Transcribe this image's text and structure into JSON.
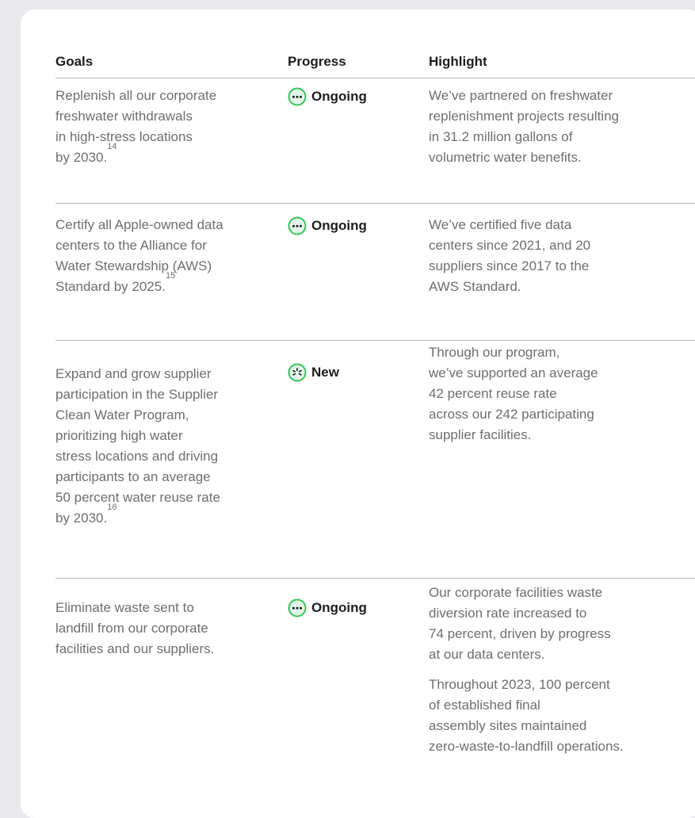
{
  "colors": {
    "accent_green": "#34c759",
    "text_primary": "#1d1d1f",
    "text_secondary": "#6e6e73",
    "rule": "#b8b8bd"
  },
  "header": {
    "goals": "Goals",
    "progress": "Progress",
    "highlight": "Highlight"
  },
  "rows": [
    {
      "goal_lines": [
        "Replenish all our corporate",
        "freshwater withdrawals",
        "in high-stress locations",
        "by 2030."
      ],
      "footnote": "14",
      "status": "Ongoing",
      "status_icon": "ellipsis-circle-icon",
      "highlight": [
        [
          "We’ve partnered on freshwater",
          "replenishment projects resulting",
          "in 31.2 million gallons of",
          "volumetric water benefits."
        ]
      ]
    },
    {
      "goal_lines": [
        "Certify all Apple-owned data",
        "centers to the Alliance for",
        "Water Stewardship (AWS)",
        "Standard by 2025."
      ],
      "footnote": "15",
      "status": "Ongoing",
      "status_icon": "ellipsis-circle-icon",
      "highlight": [
        [
          "We’ve certified five data",
          "centers since 2021, and 20",
          "suppliers since 2017 to the",
          "AWS Standard."
        ]
      ]
    },
    {
      "goal_lines": [
        "Expand and grow supplier",
        "participation in the Supplier",
        "Clean Water Program,",
        "prioritizing high water",
        "stress locations and driving",
        "participants to an average",
        "50 percent water reuse rate",
        "by 2030."
      ],
      "footnote": "16",
      "status": "New",
      "status_icon": "sparkle-burst-circle-icon",
      "highlight": [
        [
          "Through our program,",
          "we’ve supported an average",
          "42 percent reuse rate",
          "across our 242 participating",
          "supplier facilities."
        ]
      ]
    },
    {
      "goal_lines": [
        "Eliminate waste sent to",
        "landfill from our corporate",
        "facilities and our suppliers."
      ],
      "footnote": "",
      "status": "Ongoing",
      "status_icon": "ellipsis-circle-icon",
      "highlight": [
        [
          "Our corporate facilities waste",
          "diversion rate increased to",
          "74 percent, driven by progress",
          "at our data centers."
        ],
        [
          "Throughout 2023, 100 percent",
          "of established final",
          "assembly sites maintained",
          "zero-waste-to-landfill operations."
        ]
      ]
    }
  ]
}
